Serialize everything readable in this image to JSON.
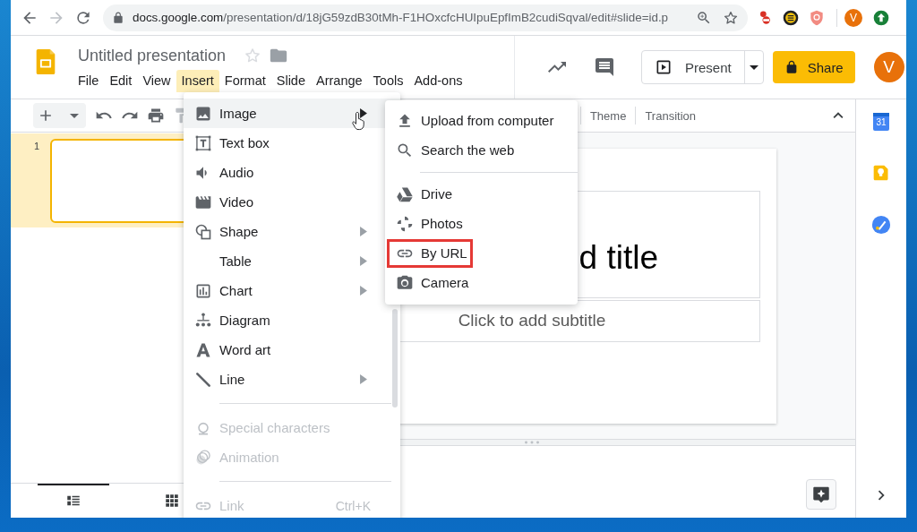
{
  "browser": {
    "url_host": "docs.google.com",
    "url_path": "/presentation/d/18jG59zdB30tMh-F1HOxcfcHUIpuEpfImB2cudiSqval/edit#slide=id.p",
    "profile_initial": "V"
  },
  "header": {
    "title": "Untitled presentation",
    "menus": [
      {
        "label": "File",
        "selected": false
      },
      {
        "label": "Edit",
        "selected": false
      },
      {
        "label": "View",
        "selected": false
      },
      {
        "label": "Insert",
        "selected": true
      },
      {
        "label": "Format",
        "selected": false
      },
      {
        "label": "Slide",
        "selected": false
      },
      {
        "label": "Arrange",
        "selected": false
      },
      {
        "label": "Tools",
        "selected": false
      },
      {
        "label": "Add-ons",
        "selected": false
      }
    ],
    "present_label": "Present",
    "share_label": "Share",
    "avatar_initial": "V"
  },
  "toolbar": {
    "buttons": [
      "Theme",
      "Transition"
    ]
  },
  "filmstrip": {
    "slides": [
      {
        "number": "1",
        "selected": true
      }
    ],
    "views": [
      {
        "selected": true
      },
      {
        "selected": false
      }
    ]
  },
  "slide": {
    "title_visible": "d title",
    "subtitle_placeholder": "Click to add subtitle"
  },
  "side_panel": {
    "calendar_label": "31"
  },
  "insert_menu": {
    "items": [
      {
        "kind": "item",
        "label": "Image",
        "submenu": true,
        "disabled": false,
        "selected": true
      },
      {
        "kind": "item",
        "label": "Text box",
        "submenu": false,
        "disabled": false,
        "selected": false
      },
      {
        "kind": "item",
        "label": "Audio",
        "submenu": false,
        "disabled": false,
        "selected": false
      },
      {
        "kind": "item",
        "label": "Video",
        "submenu": false,
        "disabled": false,
        "selected": false
      },
      {
        "kind": "item",
        "label": "Shape",
        "submenu": true,
        "disabled": false,
        "selected": false
      },
      {
        "kind": "item",
        "label": "Table",
        "submenu": true,
        "disabled": false,
        "selected": false
      },
      {
        "kind": "item",
        "label": "Chart",
        "submenu": true,
        "disabled": false,
        "selected": false
      },
      {
        "kind": "item",
        "label": "Diagram",
        "submenu": false,
        "disabled": false,
        "selected": false
      },
      {
        "kind": "item",
        "label": "Word art",
        "submenu": false,
        "disabled": false,
        "selected": false
      },
      {
        "kind": "item",
        "label": "Line",
        "submenu": true,
        "disabled": false,
        "selected": false
      },
      {
        "kind": "divider"
      },
      {
        "kind": "item",
        "label": "Special characters",
        "submenu": false,
        "disabled": true,
        "selected": false
      },
      {
        "kind": "item",
        "label": "Animation",
        "submenu": false,
        "disabled": true,
        "selected": false
      },
      {
        "kind": "divider"
      },
      {
        "kind": "item",
        "label": "Link",
        "shortcut": "Ctrl+K",
        "submenu": false,
        "disabled": true,
        "selected": false
      }
    ]
  },
  "image_submenu": {
    "items": [
      {
        "kind": "item",
        "label": "Upload from computer",
        "highlighted": false
      },
      {
        "kind": "item",
        "label": "Search the web",
        "highlighted": false
      },
      {
        "kind": "divider"
      },
      {
        "kind": "item",
        "label": "Drive",
        "highlighted": false
      },
      {
        "kind": "item",
        "label": "Photos",
        "highlighted": false
      },
      {
        "kind": "item",
        "label": "By URL",
        "highlighted": true
      },
      {
        "kind": "item",
        "label": "Camera",
        "highlighted": false
      }
    ]
  }
}
